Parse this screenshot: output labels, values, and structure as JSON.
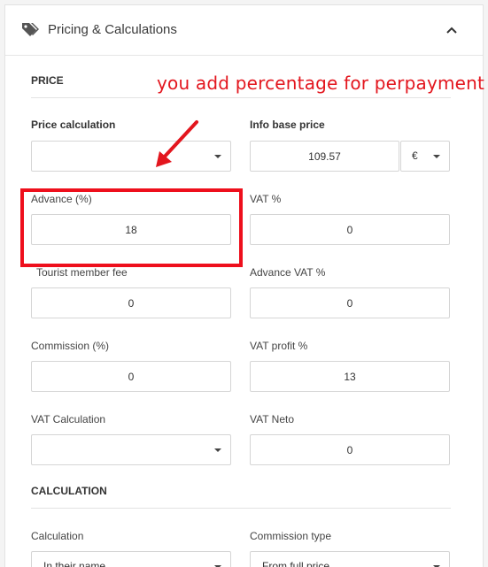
{
  "panel": {
    "title": "Pricing & Calculations",
    "icon": "tag-icon",
    "collapse_icon": "chevron-up-icon"
  },
  "sections": {
    "price": "PRICE",
    "calculation": "CALCULATION"
  },
  "annotation": {
    "text": "you add percentage for perpayment",
    "color": "#e3161e"
  },
  "fields": {
    "price_calculation": {
      "label": "Price calculation",
      "value": ""
    },
    "info_base_price": {
      "label": "Info base price",
      "value": "109.57",
      "currency": "€"
    },
    "advance": {
      "label": "Advance (%)",
      "value": "18"
    },
    "vat": {
      "label": "VAT %",
      "value": "0"
    },
    "tourist_member_fee": {
      "label": "Tourist member fee",
      "value": "0"
    },
    "advance_vat": {
      "label": "Advance VAT %",
      "value": "0"
    },
    "commission": {
      "label": "Commission (%)",
      "value": "0"
    },
    "vat_profit": {
      "label": "VAT profit %",
      "value": "13"
    },
    "vat_calculation": {
      "label": "VAT Calculation",
      "value": ""
    },
    "vat_neto": {
      "label": "VAT Neto",
      "value": "0"
    },
    "calculation": {
      "label": "Calculation",
      "value": "In their name"
    },
    "commission_type": {
      "label": "Commission type",
      "value": "From full price"
    }
  }
}
